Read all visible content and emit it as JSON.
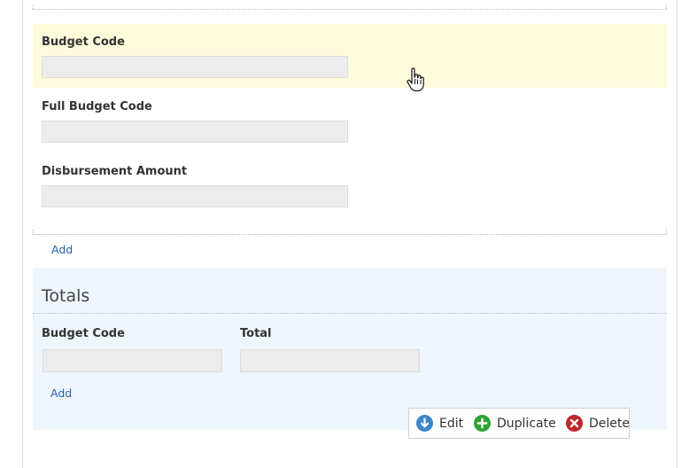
{
  "fields": [
    {
      "label": "Budget Code",
      "value": ""
    },
    {
      "label": "Full Budget Code",
      "value": ""
    },
    {
      "label": "Disbursement Amount",
      "value": ""
    }
  ],
  "repeat_add_label": "Add",
  "totals": {
    "title": "Totals",
    "columns": [
      {
        "label": "Budget Code",
        "value": ""
      },
      {
        "label": "Total",
        "value": ""
      }
    ],
    "add_label": "Add"
  },
  "toolbar": {
    "edit_label": "Edit",
    "duplicate_label": "Duplicate",
    "delete_label": "Delete"
  },
  "colors": {
    "highlight": "#fdfbdb",
    "totals_bg": "#eff5fc",
    "link": "#1f63a8",
    "edit_icon": "#3a87c8",
    "duplicate_icon": "#2fa336",
    "delete_icon": "#c0262b"
  }
}
